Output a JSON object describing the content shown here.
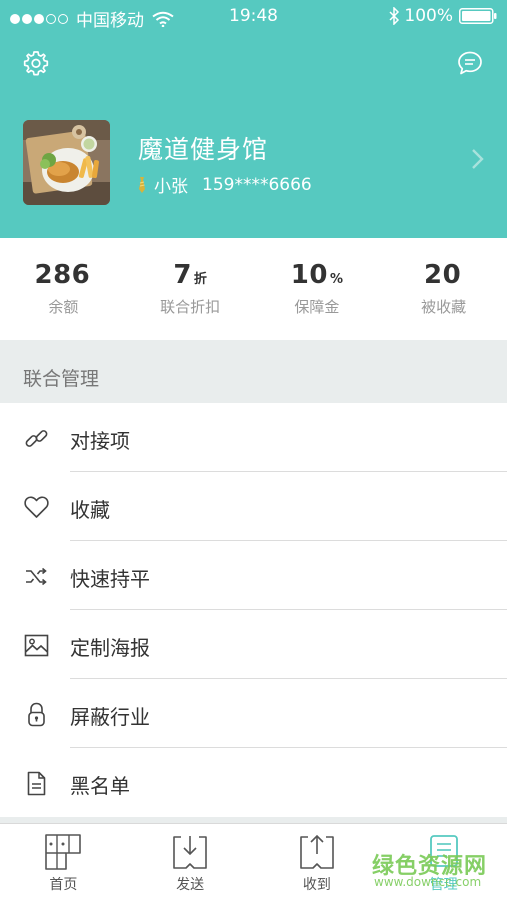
{
  "status_bar": {
    "carrier": "中国移动",
    "time": "19:48",
    "battery": "100%"
  },
  "header": {
    "gym_name": "魔道健身馆",
    "user_name": "小张",
    "phone": "159****6666"
  },
  "stats": [
    {
      "value": "286",
      "unit": "",
      "label": "余额"
    },
    {
      "value": "7",
      "unit": "折",
      "label": "联合折扣"
    },
    {
      "value": "10",
      "unit": "%",
      "label": "保障金"
    },
    {
      "value": "20",
      "unit": "",
      "label": "被收藏"
    }
  ],
  "section": {
    "title": "联合管理"
  },
  "menu": [
    {
      "label": "对接项",
      "icon": "link-icon"
    },
    {
      "label": "收藏",
      "icon": "heart-icon"
    },
    {
      "label": "快速持平",
      "icon": "shuffle-icon"
    },
    {
      "label": "定制海报",
      "icon": "image-icon"
    },
    {
      "label": "屏蔽行业",
      "icon": "lock-icon"
    },
    {
      "label": "黑名单",
      "icon": "document-icon"
    }
  ],
  "tabbar": [
    {
      "label": "首页",
      "icon": "home-grid-icon"
    },
    {
      "label": "发送",
      "icon": "send-download-icon"
    },
    {
      "label": "收到",
      "icon": "receive-upload-icon"
    },
    {
      "label": "管理",
      "icon": "manage-list-icon",
      "active": true
    }
  ],
  "watermark": {
    "title": "绿色资源网",
    "url": "www.downcc.com"
  },
  "colors": {
    "accent": "#56c9c0",
    "section_bg": "#e9eded",
    "watermark": "#7ccb5a"
  }
}
